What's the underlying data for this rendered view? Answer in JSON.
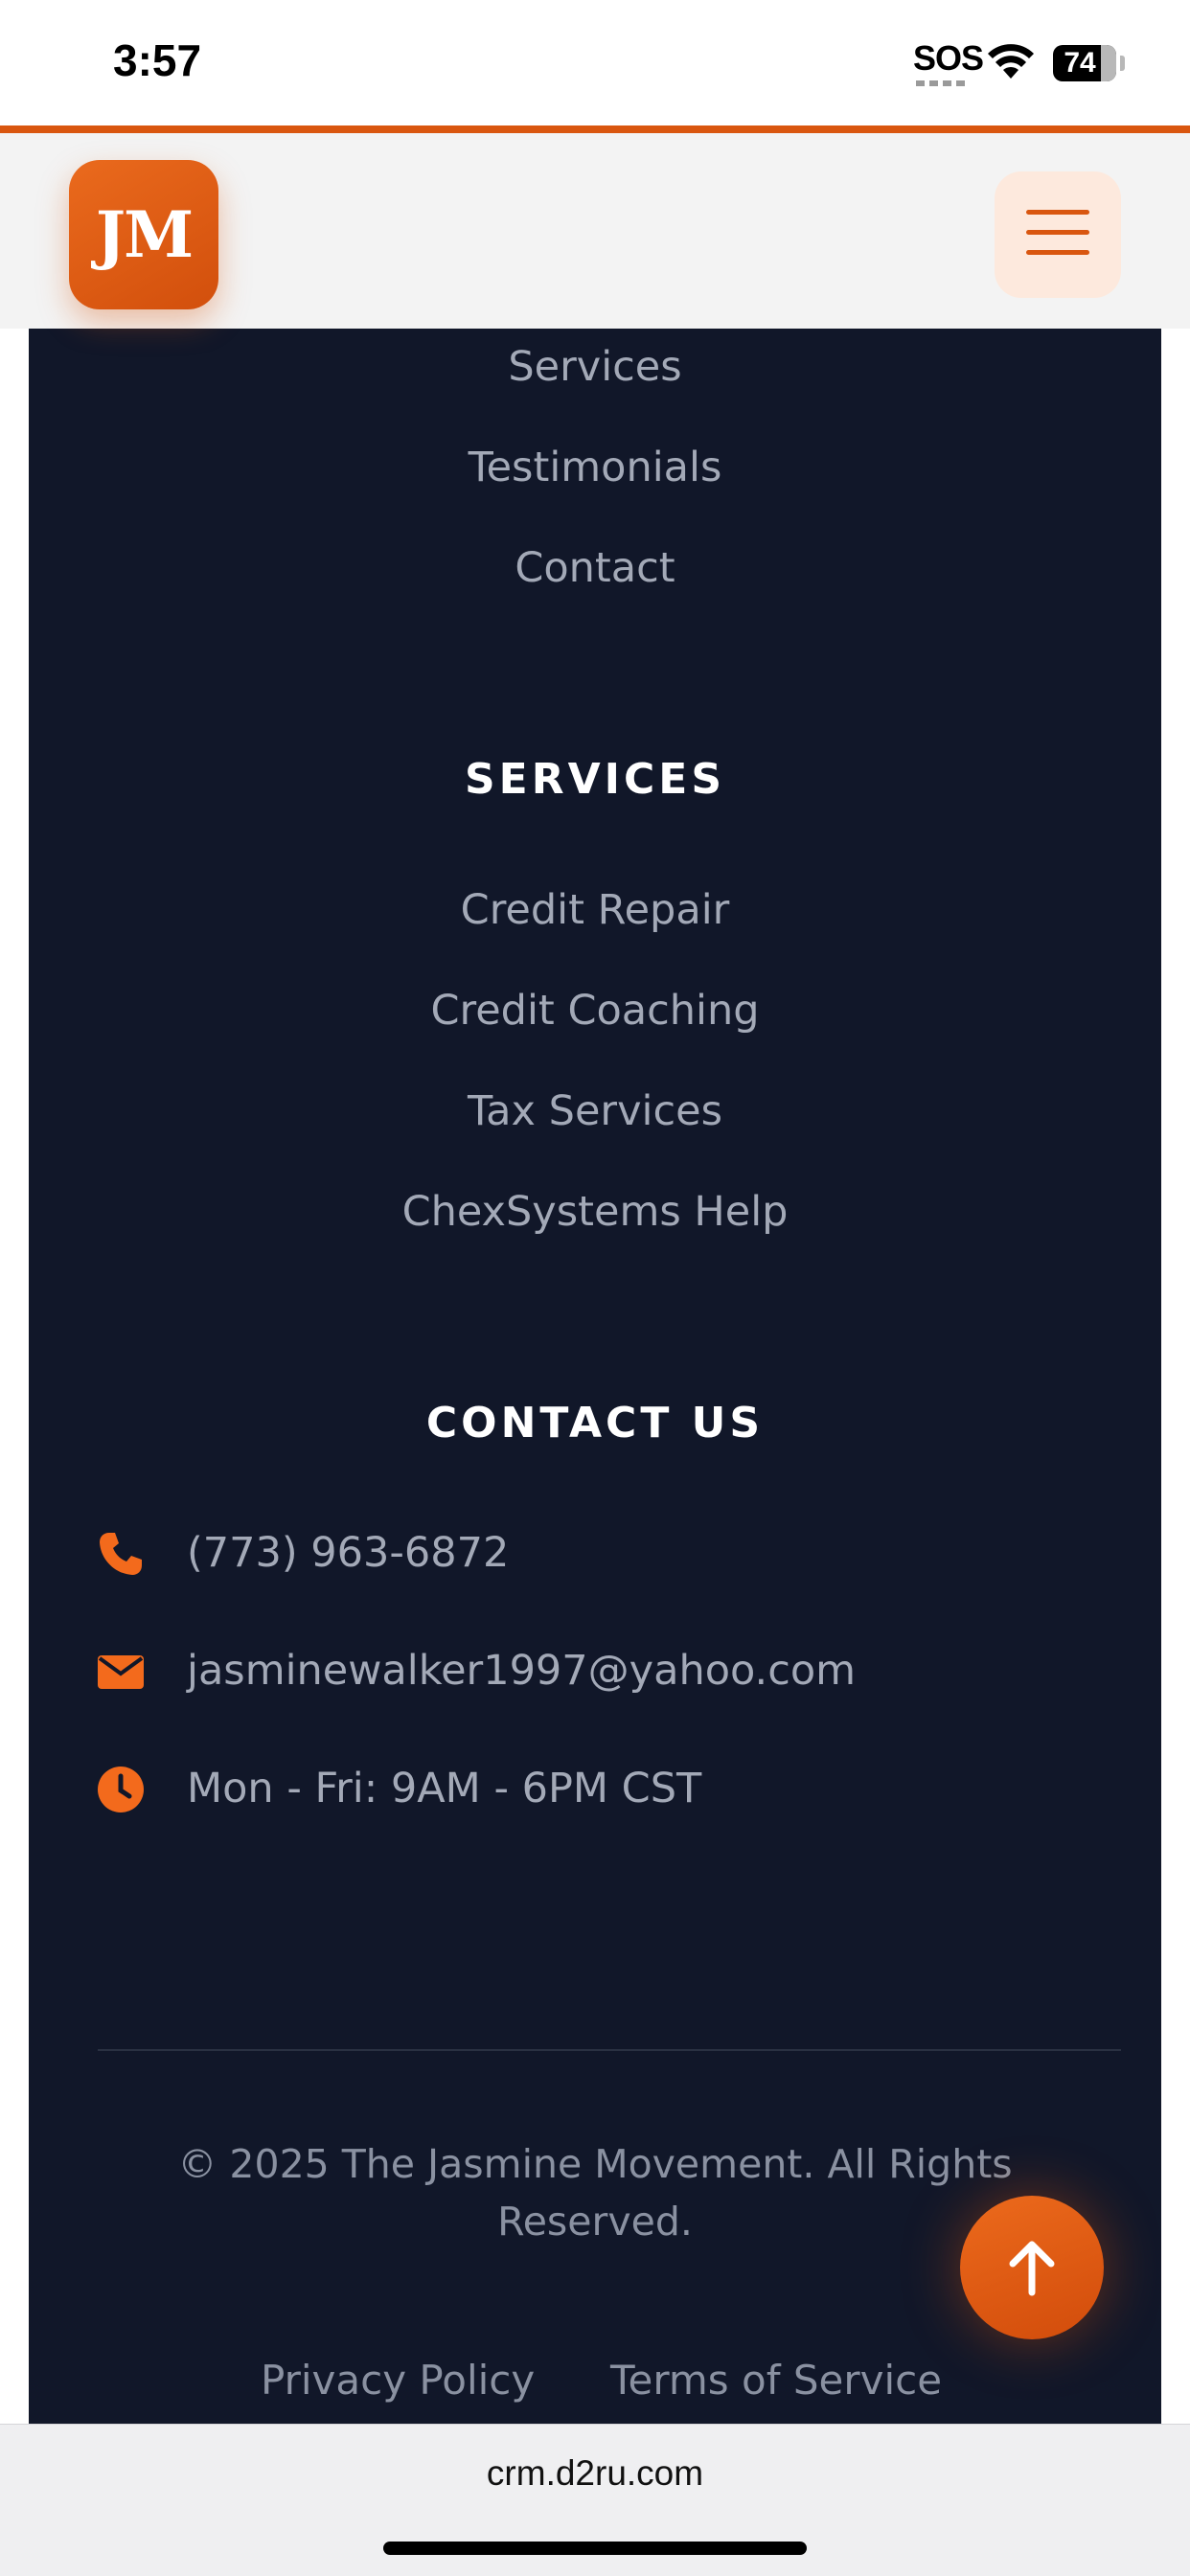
{
  "status_bar": {
    "time": "3:57",
    "sos": "SOS",
    "battery": "74"
  },
  "header": {
    "logo_text": "JM",
    "menu_icon": "hamburger-menu-icon"
  },
  "footer": {
    "quick_links": [
      "Services",
      "Testimonials",
      "Contact"
    ],
    "services_heading": "SERVICES",
    "services": [
      "Credit Repair",
      "Credit Coaching",
      "Tax Services",
      "ChexSystems Help"
    ],
    "contact_heading": "CONTACT US",
    "contact": {
      "phone": "(773) 963-6872",
      "email": "jasminewalker1997@yahoo.com",
      "hours": "Mon - Fri: 9AM - 6PM CST"
    },
    "copyright": "© 2025 The Jasmine Movement. All Rights Reserved.",
    "legal": {
      "privacy": "Privacy Policy",
      "terms": "Terms of Service"
    }
  },
  "back_to_top_icon": "arrow-up-icon",
  "browser": {
    "url": "crm.d2ru.com"
  },
  "colors": {
    "accent": "#d9560f",
    "footer_bg": "#111729",
    "header_bg": "#f3f3f3"
  }
}
